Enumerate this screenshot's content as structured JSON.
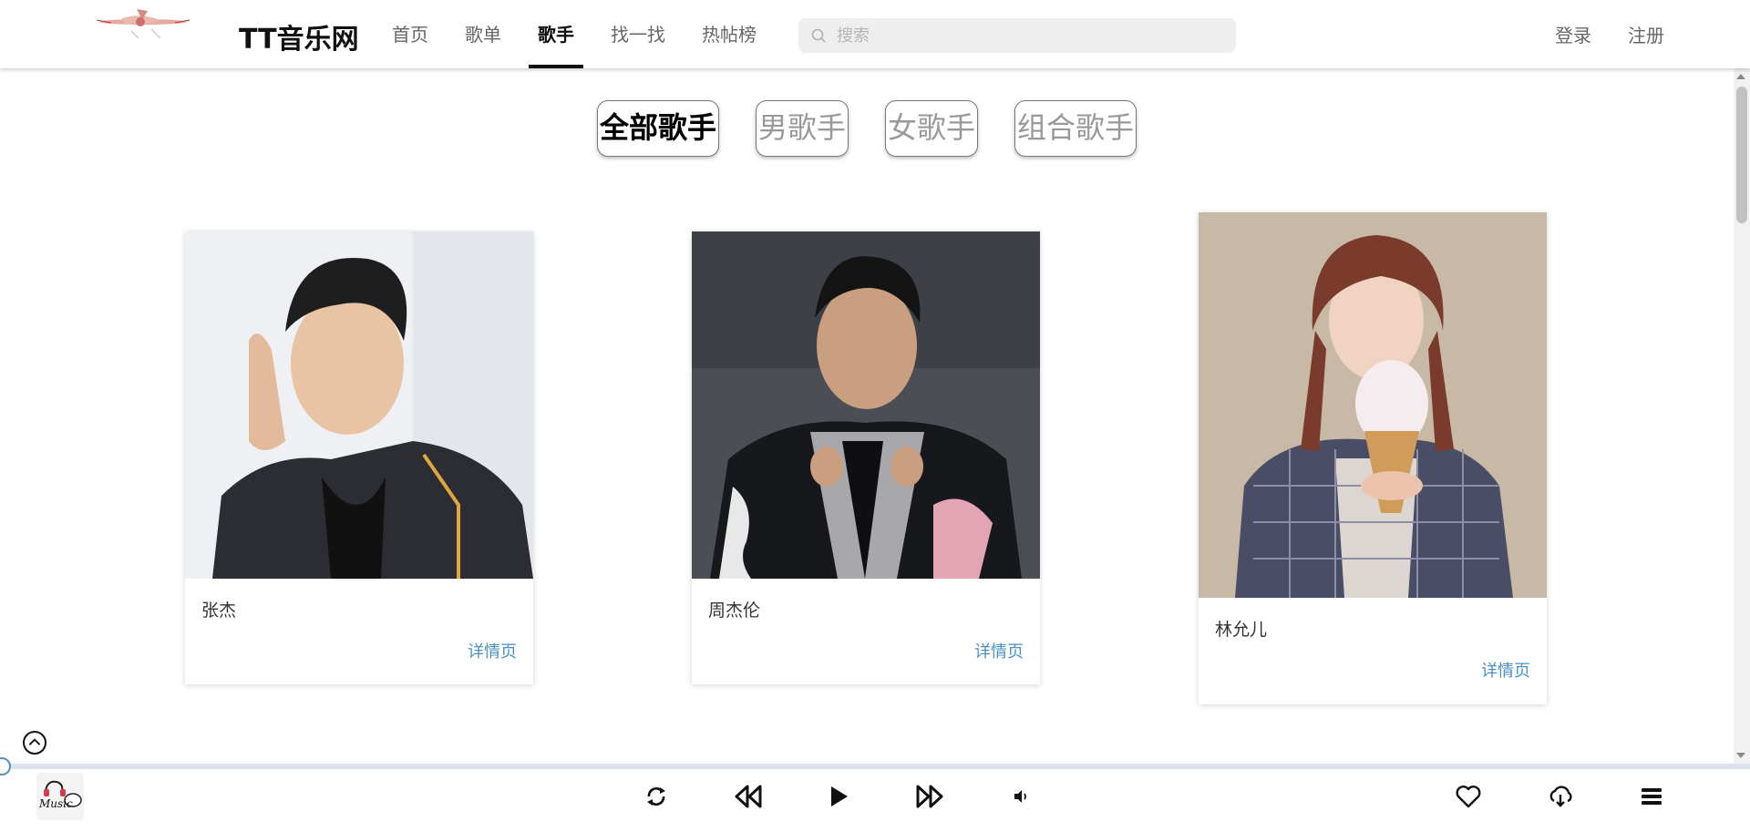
{
  "header": {
    "site_title": "TT音乐网",
    "nav": [
      "首页",
      "歌单",
      "歌手",
      "找一找",
      "热帖榜"
    ],
    "active_nav": "歌手",
    "search": {
      "placeholder": "搜索"
    },
    "login": "登录",
    "register": "注册"
  },
  "filters": [
    "全部歌手",
    "男歌手",
    "女歌手",
    "组合歌手"
  ],
  "active_filter": "全部歌手",
  "singers": [
    {
      "name": "张杰",
      "detail": "详情页"
    },
    {
      "name": "周杰伦",
      "detail": "详情页"
    },
    {
      "name": "林允儿",
      "detail": "详情页"
    }
  ],
  "player": {
    "cover_text": "Music",
    "progress": 0,
    "controls": [
      "loop-icon",
      "previous-icon",
      "play-icon",
      "next-icon",
      "volume-icon",
      "heart-icon",
      "download-icon",
      "playlist-icon"
    ]
  },
  "colors": {
    "link": "#4a8fc4",
    "progress_track": "#dde3ee",
    "active_nav": "#111111"
  }
}
